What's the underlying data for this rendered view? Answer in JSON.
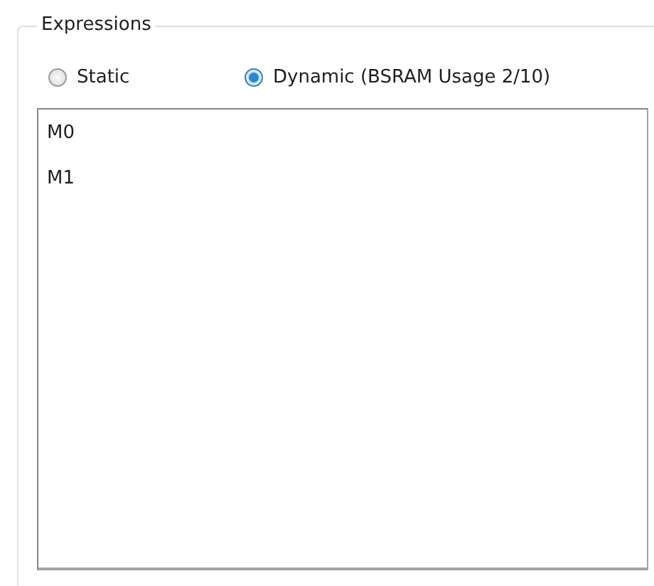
{
  "group": {
    "title": "Expressions"
  },
  "modes": [
    {
      "label": "Static",
      "selected": false
    },
    {
      "label": "Dynamic (BSRAM Usage 2/10)",
      "selected": true
    }
  ],
  "list": {
    "items": [
      {
        "label": "M0",
        "selected": false
      },
      {
        "label": "M1",
        "selected": false
      }
    ]
  }
}
